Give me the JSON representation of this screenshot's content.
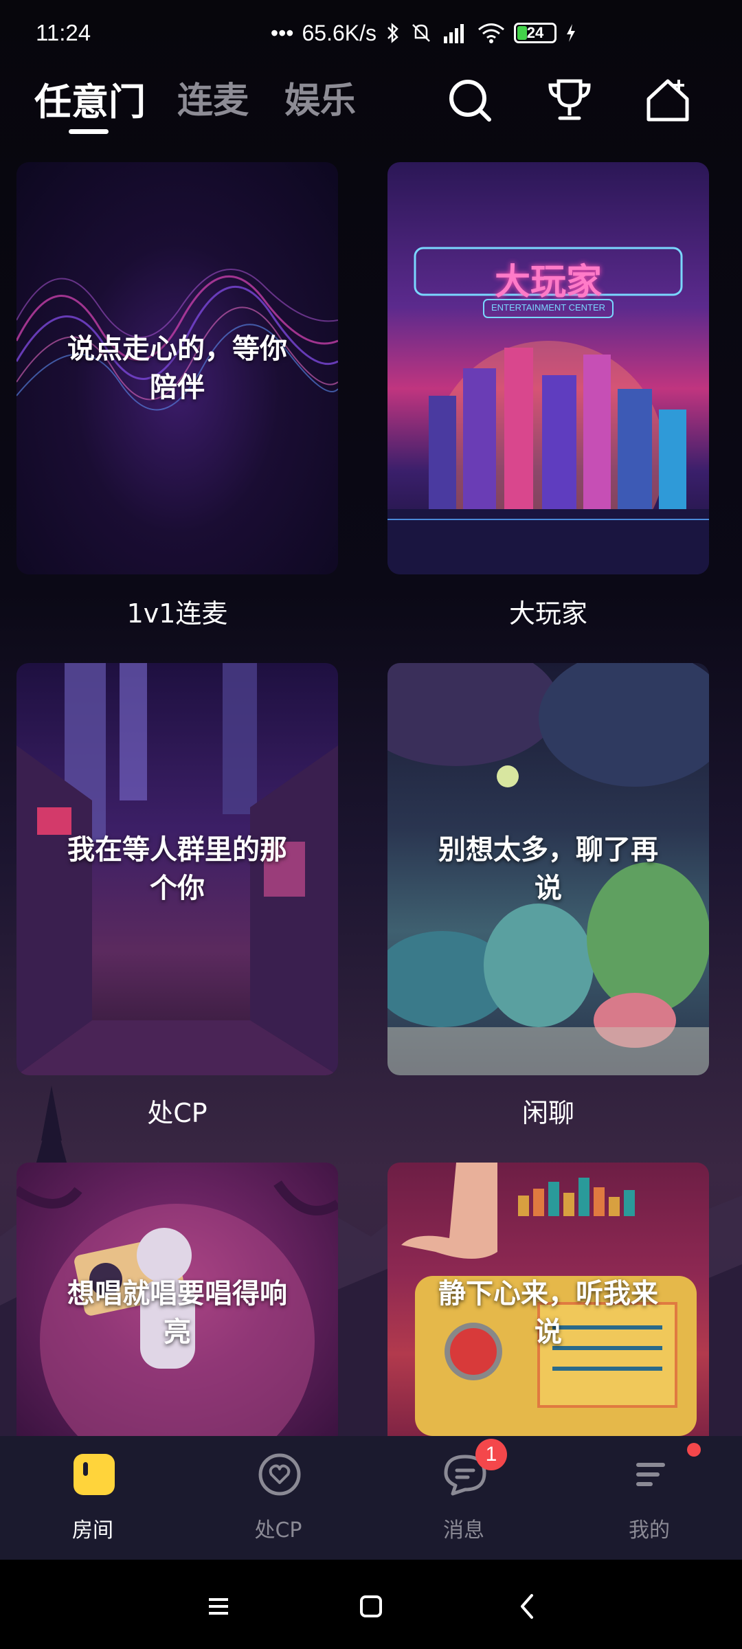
{
  "status_bar": {
    "time": "11:24",
    "network_speed": "65.6K/s",
    "battery": "24",
    "icons": [
      "bluetooth-icon",
      "mute-icon",
      "signal-icon",
      "wifi-icon",
      "battery-icon",
      "charging-icon"
    ]
  },
  "top_tabs": [
    {
      "label": "任意门",
      "active": true
    },
    {
      "label": "连麦",
      "active": false
    },
    {
      "label": "娱乐",
      "active": false
    }
  ],
  "top_actions": [
    "search-icon",
    "trophy-icon",
    "home-plus-icon"
  ],
  "cards": [
    {
      "overlay": "说点走心的，等你陪伴",
      "title": "1v1连麦"
    },
    {
      "overlay": "大玩家",
      "overlay_sub": "ENTERTAINMENT CENTER",
      "title": "大玩家"
    },
    {
      "overlay": "我在等人群里的那个你",
      "title": "处CP"
    },
    {
      "overlay": "别想太多，聊了再说",
      "title": "闲聊"
    },
    {
      "overlay": "想唱就唱要唱得响亮",
      "title": ""
    },
    {
      "overlay": "静下心来，听我来说",
      "title": ""
    }
  ],
  "bottom_nav": [
    {
      "label": "房间",
      "icon": "room-icon",
      "active": true
    },
    {
      "label": "处CP",
      "icon": "heart-chat-icon",
      "active": false
    },
    {
      "label": "消息",
      "icon": "message-icon",
      "active": false,
      "badge": "1"
    },
    {
      "label": "我的",
      "icon": "profile-menu-icon",
      "active": false,
      "dot": true
    }
  ],
  "colors": {
    "accent_yellow": "#ffd43b",
    "badge_red": "#f4474b",
    "nav_bg": "#1b1a2e"
  }
}
